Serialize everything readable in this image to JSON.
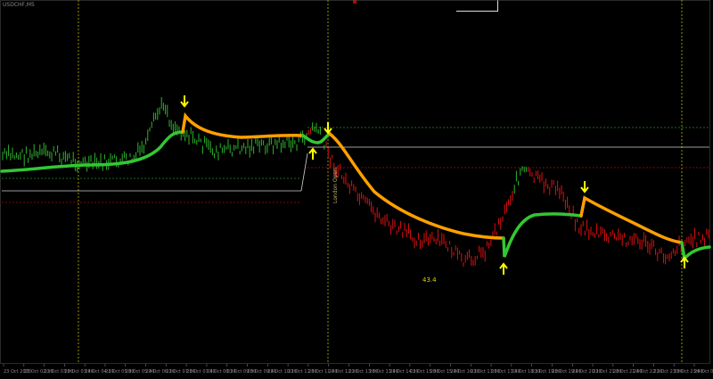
{
  "chart": {
    "symbol": "USDCHF,M5",
    "session_label": "London Open",
    "value_label": "43.4",
    "colors": {
      "background": "#000000",
      "bull_bar": "#2db52d",
      "bear_bar": "#e01010",
      "ma_up": "#32c832",
      "ma_down": "#ffa000",
      "arrow": "#ffff00",
      "session_line": "#b8b800",
      "level_green": "#1f8f1f",
      "level_red": "#a01010",
      "level_white": "#cfcfcf"
    },
    "time_labels": [
      "23 Oct 2020",
      "23 Oct 02:20",
      "23 Oct 03:00",
      "23 Oct 03:40",
      "23 Oct 04:20",
      "23 Oct 05:00",
      "23 Oct 05:40",
      "23 Oct 06:20",
      "23 Oct 07:00",
      "23 Oct 07:40",
      "23 Oct 08:20",
      "23 Oct 09:00",
      "23 Oct 09:40",
      "23 Oct 10:20",
      "23 Oct 11:00",
      "23 Oct 11:40",
      "23 Oct 12:20",
      "23 Oct 13:00",
      "23 Oct 13:40",
      "23 Oct 14:20",
      "23 Oct 15:00",
      "23 Oct 15:40",
      "23 Oct 16:20",
      "23 Oct 17:00",
      "23 Oct 17:40",
      "23 Oct 18:20",
      "23 Oct 19:00",
      "23 Oct 19:40",
      "23 Oct 20:20",
      "23 Oct 21:00",
      "23 Oct 21:40",
      "23 Oct 22:20",
      "23 Oct 23:00",
      "23 Oct 23:40",
      "26 Oct 00:20"
    ]
  }
}
